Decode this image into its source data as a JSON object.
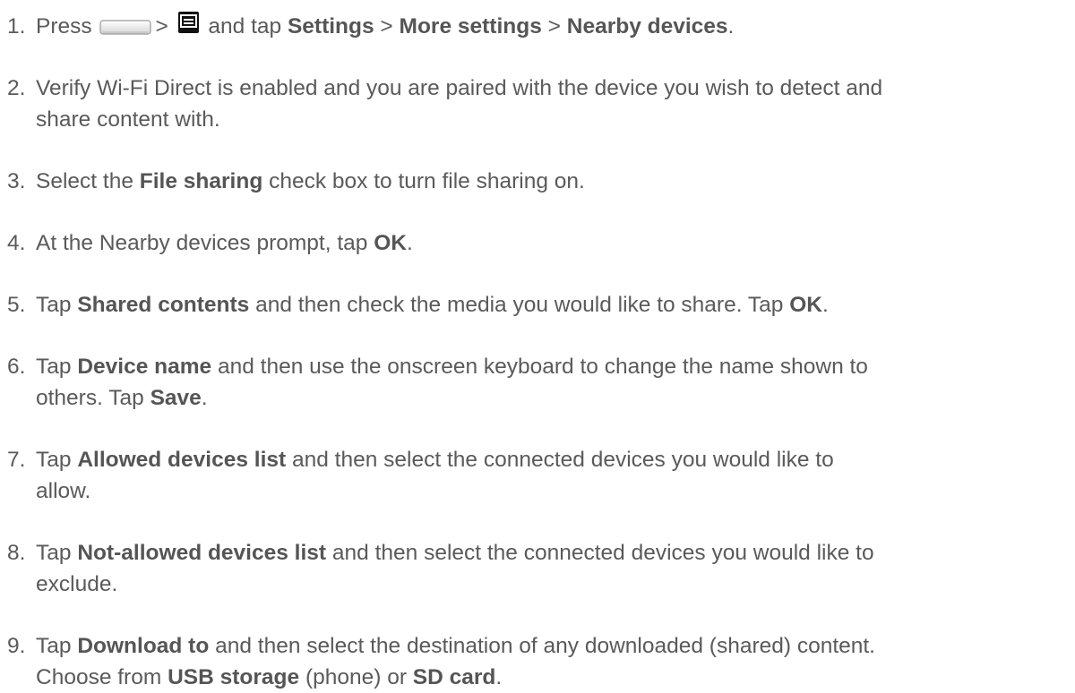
{
  "steps": [
    {
      "num": "1.",
      "parts": {
        "a": "Press",
        "b": ">",
        "c": "and tap",
        "d": "Settings",
        "e": ">",
        "f": "More settings",
        "g": ">",
        "h": "Nearby devices",
        "i": "."
      },
      "icons": [
        "home-key-icon",
        "menu-key-icon"
      ]
    },
    {
      "num": "2.",
      "line1": "Verify Wi-Fi Direct is enabled and you are paired with the device you wish to detect and",
      "line2": "share content with."
    },
    {
      "num": "3.",
      "parts": {
        "a": "Select the",
        "b": "File sharing",
        "c": "check box to turn file sharing on."
      }
    },
    {
      "num": "4.",
      "parts": {
        "a": "At the Nearby devices prompt, tap",
        "b": "OK",
        "c": "."
      }
    },
    {
      "num": "5.",
      "parts": {
        "a": "Tap",
        "b": "Shared contents",
        "c": "and then check the media you would like to share. Tap",
        "d": "OK",
        "e": "."
      }
    },
    {
      "num": "6.",
      "parts": {
        "a": "Tap",
        "b": "Device name",
        "c": "and then use the onscreen keyboard to change the name shown to",
        "d": "others. Tap",
        "e": "Save",
        "f": "."
      }
    },
    {
      "num": "7.",
      "parts": {
        "a": "Tap",
        "b": "Allowed devices list",
        "c": "and then select the connected devices you would like to",
        "d": "allow."
      }
    },
    {
      "num": "8.",
      "parts": {
        "a": "Tap",
        "b": "Not-allowed devices list",
        "c": "and then select the connected devices you would like to",
        "d": "exclude."
      }
    },
    {
      "num": "9.",
      "parts": {
        "a": "Tap",
        "b": "Download to",
        "c": "and then select the destination of any downloaded (shared) content.",
        "d": "Choose from",
        "e": "USB storage",
        "f": "(phone) or",
        "g": "SD card",
        "h": "."
      }
    }
  ]
}
